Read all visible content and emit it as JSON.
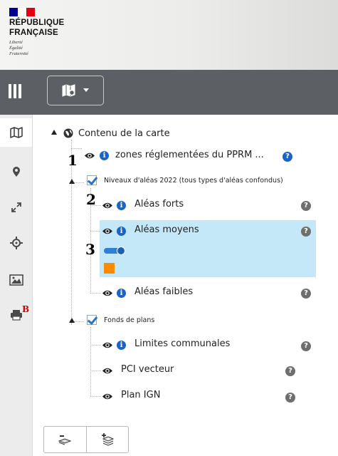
{
  "header": {
    "logo_lines": [
      "RÉPUBLIQUE",
      "FRANÇAISE"
    ],
    "motto_lines": [
      "Liberté",
      "Égalité",
      "Fraternité"
    ],
    "flag_colors": [
      "#000091",
      "#ffffff",
      "#e1000f"
    ]
  },
  "toolbar": {
    "menu_icon": "menu-bars-icon",
    "map_select_icon": "map-settings-icon",
    "dropdown_icon": "caret-down-icon"
  },
  "sidebar": {
    "items": [
      {
        "name": "map",
        "icon": "map-icon",
        "active": true
      },
      {
        "name": "location",
        "icon": "location-pin-icon"
      },
      {
        "name": "fullscreen",
        "icon": "expand-icon"
      },
      {
        "name": "geolocate",
        "icon": "crosshair-icon"
      },
      {
        "name": "image",
        "icon": "image-icon"
      },
      {
        "name": "print",
        "icon": "printer-icon",
        "badge": "B"
      }
    ]
  },
  "tree": {
    "root_label": "Contenu de la carte",
    "layers": {
      "zones": "zones réglementées du PPRM ...",
      "niveaux": "Niveaux d'aléas 2022 (tous types d'aléas confondus)",
      "forts": "Aléas forts",
      "moyens": "Aléas moyens",
      "faibles": "Aléas faibles",
      "fonds": "Fonds de plans",
      "limites": "Limites communales",
      "pci": "PCI vecteur",
      "ign": "Plan IGN"
    },
    "help_glyph": "?",
    "info_glyph": "i",
    "selected_layer_color": "#ff8a00"
  },
  "annotations": [
    "1",
    "2",
    "3"
  ],
  "bottom_buttons": {
    "collapse_icon": "collapse-layers-icon",
    "expand_icon": "expand-layers-icon"
  }
}
